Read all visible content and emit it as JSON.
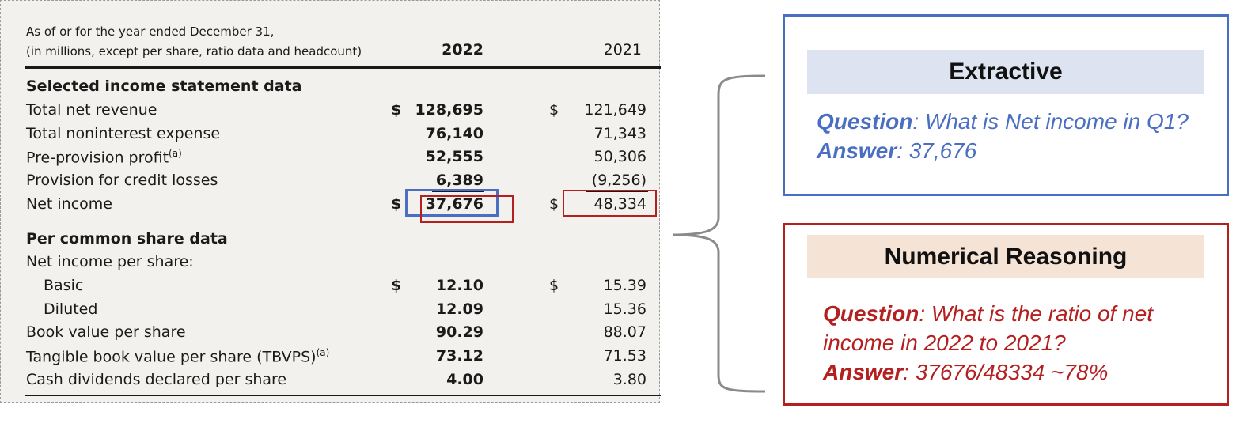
{
  "table": {
    "header_line1": "As of or for the year ended December 31,",
    "header_line2": "(in millions, except per share, ratio data and headcount)",
    "year1": "2022",
    "year2": "2021",
    "footnote_mark": "(a)",
    "dollar": "$",
    "rows": [
      {
        "label": "Selected income statement data",
        "v1": "",
        "v2": ""
      },
      {
        "label": "Total net revenue",
        "v1": "128,695",
        "v2": "121,649"
      },
      {
        "label": "Total noninterest expense",
        "v1": "76,140",
        "v2": "71,343"
      },
      {
        "label": "Pre-provision profit",
        "v1": "52,555",
        "v2": "50,306"
      },
      {
        "label": "Provision for credit losses",
        "v1": "6,389",
        "v2": "(9,256)"
      },
      {
        "label": "Net income",
        "v1": "37,676",
        "v2": "48,334"
      },
      {
        "label": "Per common share data",
        "v1": "",
        "v2": ""
      },
      {
        "label": "Net income per share:",
        "v1": "",
        "v2": ""
      },
      {
        "label": "Basic",
        "v1": "12.10",
        "v2": "15.39"
      },
      {
        "label": "Diluted",
        "v1": "12.09",
        "v2": "15.36"
      },
      {
        "label": "Book value per share",
        "v1": "90.29",
        "v2": "88.07"
      },
      {
        "label": "Tangible book value per share (TBVPS)",
        "v1": "73.12",
        "v2": "71.53"
      },
      {
        "label": "Cash dividends declared per share",
        "v1": "4.00",
        "v2": "3.80"
      }
    ]
  },
  "extractive": {
    "title": "Extractive",
    "question_label": "Question",
    "question": ": What is Net income in Q1?",
    "answer_label": "Answer",
    "answer": ": 37,676"
  },
  "reasoning": {
    "title": "Numerical Reasoning",
    "question_label": "Question",
    "question_line1": ": What is the ratio of net",
    "question_line2": "income in 2022 to 2021?",
    "answer_label": "Answer",
    "answer": ": 37676/48334 ~78%"
  },
  "colors": {
    "blue": "#4a6fc2",
    "red": "#b3201f",
    "blue_band": "#dde3f0",
    "red_band": "#f5e3d6",
    "panel_bg": "#f3f1ee"
  }
}
